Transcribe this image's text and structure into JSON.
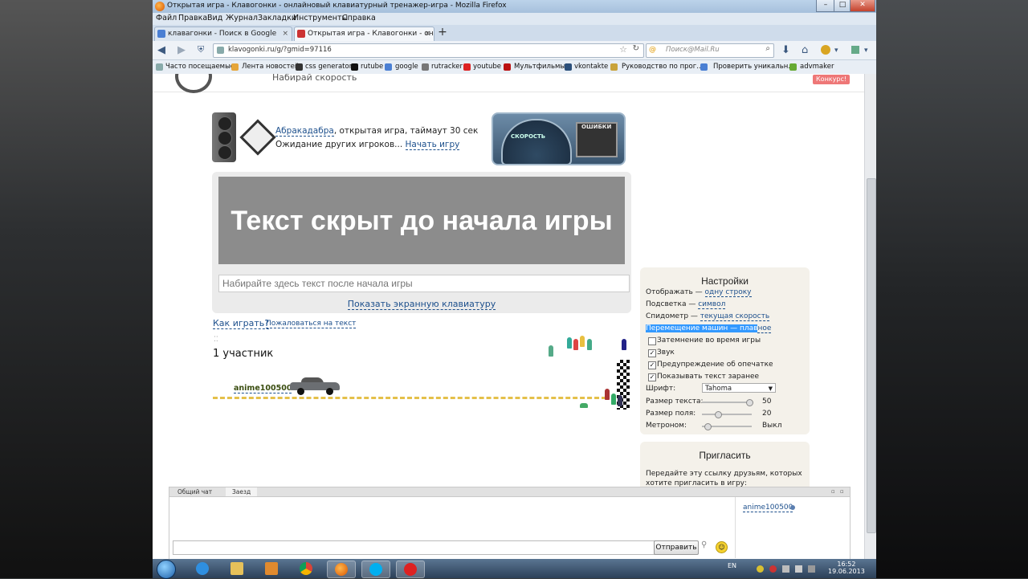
{
  "browser": {
    "title": "Открытая игра - Клавогонки - онлайновый клавиатурный тренажер-игра - Mozilla Firefox",
    "window_controls": {
      "minimize": "–",
      "maximize": "□",
      "close": "✕"
    },
    "menu": [
      "Файл",
      "Правка",
      "Вид",
      "Журнал",
      "Закладки",
      "Инструменты",
      "Справка"
    ],
    "tabs": [
      {
        "label": "клавагонки - Поиск в Google",
        "close": "×"
      },
      {
        "label": "Открытая игра - Клавогонки - онла...",
        "close": "×"
      }
    ],
    "new_tab": "+",
    "nav": {
      "back": "◀",
      "forward": "▶",
      "identity": "⛨",
      "home": "⌂",
      "download": "⬇",
      "menu": "▾"
    },
    "url": "klavogonki.ru/g/?gmid=97116",
    "url_star": "☆",
    "url_reload": "↻",
    "search_logo": "@",
    "search_placeholder": "Поиск@Mail.Ru",
    "search_icon": "⌕",
    "bookmarks": [
      "Часто посещаемые",
      "Лента новостей",
      "css generator",
      "rutube",
      "google",
      "rutracker",
      "youtube",
      "Мультфильмы",
      "vkontakte",
      "Руководство по прог...",
      "Проверить уникальн...",
      "advmaker"
    ]
  },
  "site": {
    "slogan": "Набирай скорость",
    "contest": "Конкурс!"
  },
  "game": {
    "status_name": "Абракадабра",
    "status_rest": ", открытая игра, таймаут 30 сек",
    "waiting": "Ожидание других игроков...",
    "start_link": "Начать игру",
    "speed_label": "СКОРОСТЬ",
    "errors_label": "ОШИБКИ",
    "hidden_text": "Текст скрыт до начала игры",
    "input_placeholder": "Набирайте здесь текст после начала игры",
    "show_keyboard": "Показать экранную клавиатуру",
    "how_to_play": "Как играть?",
    "complain": "Пожаловаться на текст",
    "participants": "1 участник",
    "player_name": "anime100500"
  },
  "settings": {
    "title": "Настройки",
    "display_label": "Отображать — ",
    "display_value": "одну строку",
    "highlight_label": "Подсветка — ",
    "highlight_value": "символ",
    "speedometer_label": "Спидометр — ",
    "speedometer_value": "текущая скорость",
    "movement_label": "Перемещение машин — плав",
    "movement_value": "ное",
    "check_dim": "Затемнение во время игры",
    "check_sound": "Звук",
    "check_typo": "Предупреждение об опечатке",
    "check_preview": "Показывать текст заранее",
    "checkmark": "✓",
    "font_label": "Шрифт:",
    "font_value": "Tahoma",
    "font_arrow": "▼",
    "text_size_label": "Размер текста:",
    "text_size_value": "50",
    "text_size_level": 0.88,
    "field_size_label": "Размер поля:",
    "field_size_value": "20",
    "field_size_level": 0.25,
    "metronome_label": "Метроном:",
    "metronome_value": "Выкл",
    "metronome_level": 0.05
  },
  "invite": {
    "title": "Пригласить",
    "text": "Передайте эту ссылку друзьям, которых хотите пригласить в игру:"
  },
  "chat": {
    "tab_general": "Общий чат",
    "tab_race": "Заезд",
    "icon_min": "▫",
    "icon_close": "▫",
    "user": "anime100500",
    "send": "Отправить",
    "filter_icon": "⚲",
    "smile_icon": "☺"
  },
  "taskbar": {
    "lang": "EN",
    "time": "16:52",
    "date": "19.06.2013"
  }
}
